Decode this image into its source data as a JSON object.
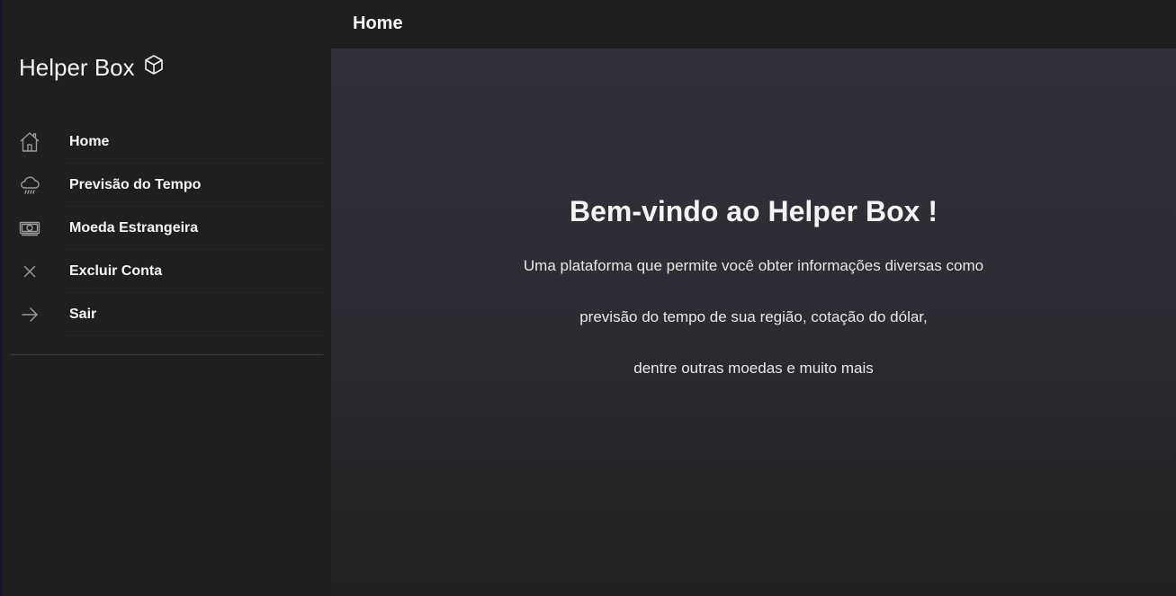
{
  "brand": {
    "title": "Helper Box",
    "icon": "cube-icon"
  },
  "nav": {
    "items": [
      {
        "label": "Home",
        "icon": "home-icon"
      },
      {
        "label": "Previsão do Tempo",
        "icon": "rain-cloud-icon"
      },
      {
        "label": "Moeda Estrangeira",
        "icon": "banknote-icon"
      },
      {
        "label": "Excluir Conta",
        "icon": "close-icon"
      },
      {
        "label": "Sair",
        "icon": "arrow-right-icon"
      }
    ]
  },
  "topbar": {
    "title": "Home"
  },
  "main": {
    "heading": "Bem-vindo ao Helper Box !",
    "lines": [
      "Uma plataforma que permite você obter informações diversas como",
      "previsão do tempo de sua região, cotação do dólar,",
      "dentre outras moedas e muito mais"
    ]
  },
  "colors": {
    "sidebar_bg": "#1f1f1f",
    "topbar_bg": "#1e1e1e",
    "main_bg_top": "#32303a",
    "main_bg_bottom": "#212122",
    "text": "#f5f5f5",
    "icon": "#9a9a9a"
  }
}
